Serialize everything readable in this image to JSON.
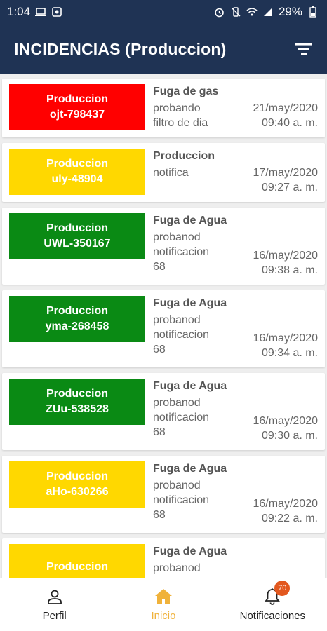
{
  "status_bar": {
    "time": "1:04",
    "battery": "29%",
    "left_icons": [
      "laptop-icon",
      "square-notification-icon"
    ],
    "right_icons": [
      "alarm-icon",
      "mute-vibrate-icon",
      "wifi-icon",
      "signal-icon",
      "battery-icon"
    ]
  },
  "app_bar": {
    "title": "INCIDENCIAS (Produccion)",
    "filter_icon": "filter-icon",
    "background_color": "#1f3354"
  },
  "incidents": [
    {
      "badge_line1": "Produccion",
      "badge_line2": "ojt-798437",
      "badge_color": "red",
      "title": "Fuga de gas",
      "description": "probando\nfiltro de dia",
      "date": "21/may/2020",
      "time": "09:40 a. m."
    },
    {
      "badge_line1": "Produccion",
      "badge_line2": "uly-48904",
      "badge_color": "yellow",
      "title": "Produccion",
      "description": "notifica",
      "date": "17/may/2020",
      "time": "09:27 a. m."
    },
    {
      "badge_line1": "Produccion",
      "badge_line2": "UWL-350167",
      "badge_color": "green",
      "title": "Fuga de Agua",
      "description": " probanod\nnotificacion\n68",
      "date": "16/may/2020",
      "time": "09:38 a. m."
    },
    {
      "badge_line1": "Produccion",
      "badge_line2": "yma-268458",
      "badge_color": "green",
      "title": "Fuga de Agua",
      "description": " probanod\nnotificacion\n68",
      "date": "16/may/2020",
      "time": "09:34 a. m."
    },
    {
      "badge_line1": "Produccion",
      "badge_line2": "ZUu-538528",
      "badge_color": "green",
      "title": "Fuga de Agua",
      "description": " probanod\nnotificacion\n68",
      "date": "16/may/2020",
      "time": "09:30 a. m."
    },
    {
      "badge_line1": "Produccion",
      "badge_line2": "aHo-630266",
      "badge_color": "yellow",
      "title": "Fuga de Agua",
      "description": " probanod\nnotificacion\n68",
      "date": "16/may/2020",
      "time": "09:22 a. m."
    },
    {
      "badge_line1": "Produccion",
      "badge_line2": "",
      "badge_color": "yellow",
      "title": "Fuga de Agua",
      "description": " probanod",
      "date": "",
      "time": ""
    }
  ],
  "bottom_nav": {
    "items": [
      {
        "label": "Perfil",
        "icon": "person-icon",
        "active": false
      },
      {
        "label": "Inicio",
        "icon": "home-icon",
        "active": true
      },
      {
        "label": "Notificaciones",
        "icon": "bell-icon",
        "active": false,
        "badge": "70"
      }
    ],
    "active_color": "#f0b23b"
  }
}
